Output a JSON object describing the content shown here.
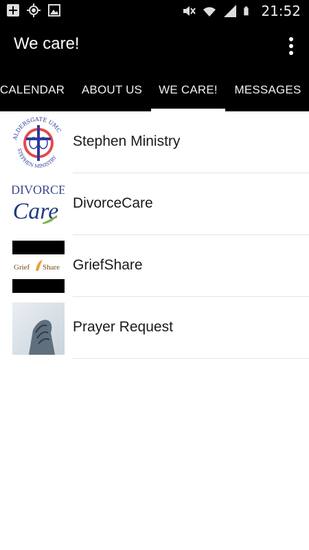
{
  "status_bar": {
    "time": "21:52",
    "left_icons": [
      "add-box-icon",
      "gps-icon",
      "image-icon"
    ],
    "right_icons": [
      "mute-icon",
      "wifi-icon",
      "signal-icon",
      "battery-icon"
    ]
  },
  "app_bar": {
    "title": "We care!",
    "overflow_icon": "more-vert-icon"
  },
  "tabs": [
    {
      "label": "CALENDAR",
      "active": false
    },
    {
      "label": "ABOUT US",
      "active": false
    },
    {
      "label": "WE CARE!",
      "active": true
    },
    {
      "label": "MESSAGES",
      "active": false
    }
  ],
  "list": {
    "items": [
      {
        "label": "Stephen Ministry",
        "thumb": {
          "icon": "stephen-ministry-logo",
          "text_top": "ALDERSGATE UMC",
          "text_bottom": "STEPHEN MINISTRY"
        }
      },
      {
        "label": "DivorceCare",
        "thumb": {
          "icon": "divorcecare-logo",
          "text_top": "DIVORCE",
          "text_bottom": "Care"
        }
      },
      {
        "label": "GriefShare",
        "thumb": {
          "icon": "griefshare-logo",
          "text_top": "Grief",
          "text_bottom": "Share"
        }
      },
      {
        "label": "Prayer Request",
        "thumb": {
          "icon": "praying-hands-photo"
        }
      }
    ]
  },
  "colors": {
    "bar_background": "#000000",
    "text_on_bar": "#ffffff",
    "list_text": "#1a1a1a",
    "divider": "#e3e3e3"
  }
}
